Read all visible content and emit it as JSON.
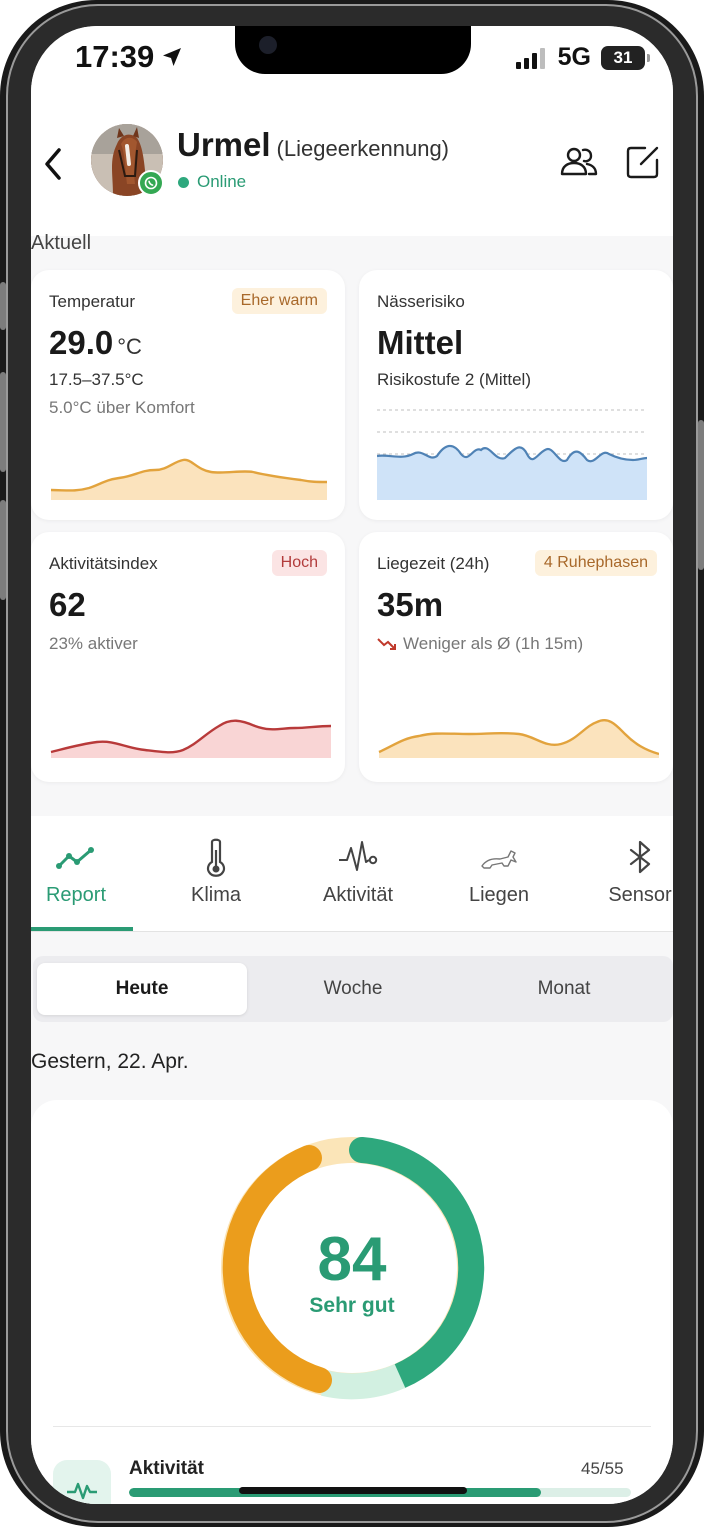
{
  "status": {
    "time": "17:39",
    "network": "5G",
    "battery": "31"
  },
  "header": {
    "name": "Urmel",
    "mode": "(Liegeerkennung)",
    "status": "Online"
  },
  "section_label": "Aktuell",
  "cards": {
    "temp": {
      "title": "Temperatur",
      "badge": "Eher warm",
      "value": "29.0",
      "unit": "°C",
      "range": "17.5–37.5°C",
      "comfort": "5.0°C über Komfort"
    },
    "wet": {
      "title": "Nässerisiko",
      "value": "Mittel",
      "level": "Risikostufe 2 (Mittel)"
    },
    "activity": {
      "title": "Aktivitätsindex",
      "badge": "Hoch",
      "value": "62",
      "sub": "23% aktiver"
    },
    "lying": {
      "title": "Liegezeit (24h)",
      "badge": "4 Ruhephasen",
      "value": "35m",
      "sub": "Weniger als Ø (1h 15m)"
    }
  },
  "tabs": [
    {
      "label": "Report",
      "icon": "trend-line-icon"
    },
    {
      "label": "Klima",
      "icon": "thermometer-icon"
    },
    {
      "label": "Aktivität",
      "icon": "heartbeat-icon"
    },
    {
      "label": "Liegen",
      "icon": "horse-lying-icon"
    },
    {
      "label": "Sensor",
      "icon": "bluetooth-icon"
    }
  ],
  "active_tab": "Report",
  "segments": {
    "today": "Heute",
    "week": "Woche",
    "month": "Monat",
    "selected": "Heute"
  },
  "date_label": "Gestern, 22. Apr.",
  "score": {
    "value": "84",
    "label": "Sehr gut"
  },
  "score_ring": {
    "segments": [
      {
        "name": "green",
        "fraction": 0.42,
        "color": "#2ea87d"
      },
      {
        "name": "light-green",
        "fraction": 0.1,
        "color": "#d2f0e1"
      },
      {
        "name": "orange",
        "fraction": 0.4,
        "color": "#eb9d1c"
      },
      {
        "name": "light-orange",
        "fraction": 0.08,
        "color": "#fbe5b8"
      }
    ]
  },
  "metric": {
    "name": "Aktivität",
    "value": "45/55",
    "progress": 0.82
  },
  "colors": {
    "accent": "#2a9b74",
    "warm": "#e8a83a",
    "danger": "#c0392b"
  }
}
